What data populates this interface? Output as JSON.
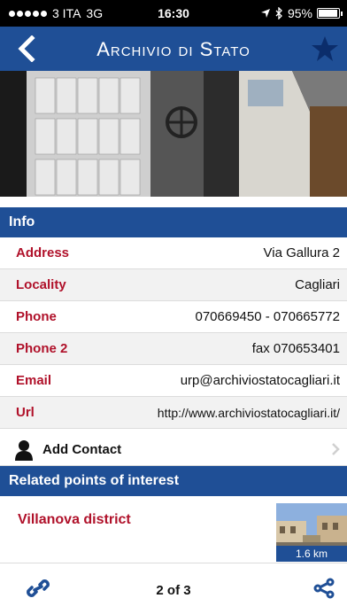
{
  "status": {
    "carrier": "3 ITA",
    "network": "3G",
    "time": "16:30",
    "battery": "95%",
    "battery_level": 0.95
  },
  "nav": {
    "title": "Archivio di Stato",
    "back_icon": "chevron-left-icon",
    "favorite_icon": "star-icon"
  },
  "info": {
    "header": "Info",
    "rows": [
      {
        "label": "Address",
        "value": "Via Gallura 2"
      },
      {
        "label": "Locality",
        "value": "Cagliari"
      },
      {
        "label": "Phone",
        "value": "070669450 - 070665772"
      },
      {
        "label": "Phone 2",
        "value": "fax 070653401"
      },
      {
        "label": "Email",
        "value": "urp@archiviostatocagliari.it"
      },
      {
        "label": "Url",
        "value": "http://www.archiviostatocagliari.it/"
      }
    ],
    "add_contact": "Add Contact"
  },
  "related": {
    "header": "Related points of interest",
    "items": [
      {
        "name": "Villanova district",
        "distance": "1.6 km"
      }
    ]
  },
  "toolbar": {
    "pager": "2 of 3"
  },
  "colors": {
    "primary": "#1f4f96",
    "label": "#b0112a"
  }
}
